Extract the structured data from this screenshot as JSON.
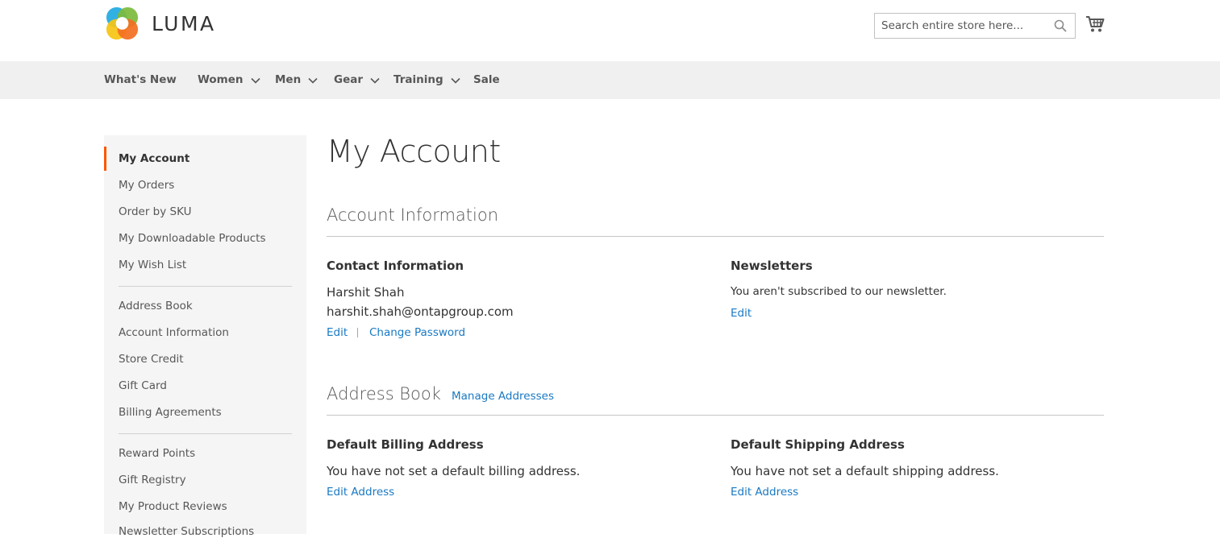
{
  "header": {
    "logo_text": "LUMA",
    "search": {
      "placeholder": "Search entire store here..."
    },
    "icons": [
      "luma-logo",
      "search-icon",
      "cart-icon"
    ]
  },
  "nav": {
    "items": [
      {
        "label": "What's New",
        "has_dropdown": false
      },
      {
        "label": "Women",
        "has_dropdown": true
      },
      {
        "label": "Men",
        "has_dropdown": true
      },
      {
        "label": "Gear",
        "has_dropdown": true
      },
      {
        "label": "Training",
        "has_dropdown": true
      },
      {
        "label": "Sale",
        "has_dropdown": false
      }
    ]
  },
  "sidebar": {
    "accent_color": "#ff5501",
    "items": [
      {
        "label": "My Account",
        "active": true
      },
      {
        "label": "My Orders"
      },
      {
        "label": "Order by SKU"
      },
      {
        "label": "My Downloadable Products"
      },
      {
        "label": "My Wish List"
      },
      {
        "label": "Address Book"
      },
      {
        "label": "Account Information"
      },
      {
        "label": "Store Credit"
      },
      {
        "label": "Gift Card"
      },
      {
        "label": "Billing Agreements"
      },
      {
        "label": "Reward Points"
      },
      {
        "label": "Gift Registry"
      },
      {
        "label": "My Product Reviews"
      },
      {
        "label": "Newsletter Subscriptions"
      }
    ]
  },
  "main": {
    "page_title": "My Account",
    "account_info": {
      "title": "Account Information",
      "contact": {
        "title": "Contact Information",
        "name": "Harshit Shah",
        "email": "harshit.shah@ontapgroup.com",
        "edit_label": "Edit",
        "change_password_label": "Change Password"
      },
      "newsletters": {
        "title": "Newsletters",
        "text": "You aren't subscribed to our newsletter.",
        "edit_label": "Edit"
      }
    },
    "address_book": {
      "title": "Address Book",
      "manage_label": "Manage Addresses",
      "billing": {
        "title": "Default Billing Address",
        "text": "You have not set a default billing address.",
        "edit_label": "Edit Address"
      },
      "shipping": {
        "title": "Default Shipping Address",
        "text": "You have not set a default shipping address.",
        "edit_label": "Edit Address"
      }
    },
    "link_color": "#1979c3"
  }
}
